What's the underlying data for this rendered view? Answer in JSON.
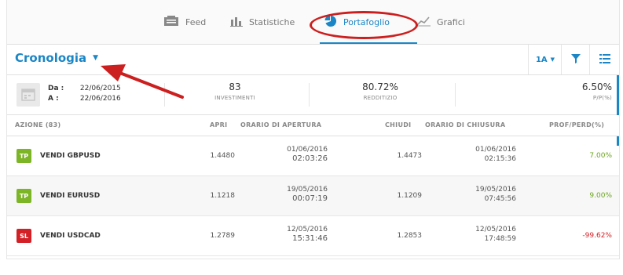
{
  "nav": {
    "tabs": [
      {
        "label": "Feed",
        "icon": "feed-icon"
      },
      {
        "label": "Statistiche",
        "icon": "bar-chart-icon"
      },
      {
        "label": "Portafoglio",
        "icon": "pie-chart-icon",
        "active": true
      },
      {
        "label": "Grafici",
        "icon": "line-chart-icon"
      }
    ]
  },
  "header": {
    "title": "Cronologia",
    "period_label": "1A"
  },
  "summary": {
    "from_label": "Da :",
    "from_date": "22/06/2015",
    "to_label": "A :",
    "to_date": "22/06/2016",
    "investments_value": "83",
    "investments_label": "INVESTIMENTI",
    "return_value": "80.72%",
    "return_label": "REDDITIZIO",
    "pl_value": "6.50%",
    "pl_label": "P/P(%)"
  },
  "table": {
    "columns": {
      "asset": "AZIONE (83)",
      "open": "APRI",
      "open_time": "ORARIO DI APERTURA",
      "close": "CHIUDI",
      "close_time": "ORARIO DI CHIUSURA",
      "pl": "PROF/PERD(%)"
    },
    "rows": [
      {
        "badge": "TP",
        "asset": "VENDI GBPUSD",
        "open": "1.4480",
        "open_date": "01/06/2016",
        "open_time": "02:03:26",
        "close": "1.4473",
        "close_date": "01/06/2016",
        "close_time": "02:15:36",
        "pl": "7.00%"
      },
      {
        "badge": "TP",
        "asset": "VENDI EURUSD",
        "open": "1.1218",
        "open_date": "19/05/2016",
        "open_time": "00:07:19",
        "close": "1.1209",
        "close_date": "19/05/2016",
        "close_time": "07:45:56",
        "pl": "9.00%"
      },
      {
        "badge": "SL",
        "asset": "VENDI USDCAD",
        "open": "1.2789",
        "open_date": "12/05/2016",
        "open_time": "15:31:46",
        "close": "1.2853",
        "close_date": "12/05/2016",
        "close_time": "17:48:59",
        "pl": "-99.62%"
      }
    ]
  },
  "colors": {
    "accent": "#1b86c6",
    "tp_badge": "#7cb526",
    "sl_badge": "#d32027",
    "positive": "#6aa51e",
    "negative": "#d32027",
    "annotation": "#cc1f1f"
  }
}
